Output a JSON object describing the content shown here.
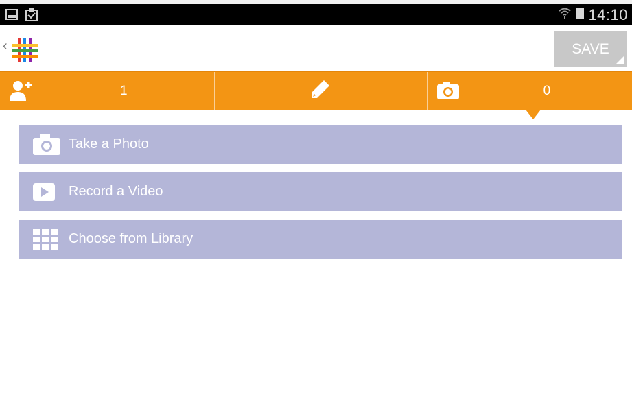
{
  "status_bar": {
    "time": "14:10",
    "icons": [
      "image-notification-icon",
      "clipboard-check-icon",
      "wifi-icon",
      "battery-icon"
    ]
  },
  "action_bar": {
    "save_label": "SAVE",
    "icons": [
      "back-chevron-icon",
      "app-logo-icon"
    ]
  },
  "tabs": {
    "people_count": "1",
    "photo_count": "0",
    "icons": [
      "add-person-icon",
      "pencil-icon",
      "camera-icon"
    ]
  },
  "options": {
    "take_photo": "Take a Photo",
    "record_video": "Record a Video",
    "choose_library": "Choose from Library",
    "icons": [
      "camera-icon",
      "play-icon",
      "grid-icon"
    ]
  },
  "colors": {
    "accent_orange": "#f39514",
    "option_background": "#b4b6d8",
    "save_button": "#c8c8c8",
    "status_bar": "#000000"
  }
}
